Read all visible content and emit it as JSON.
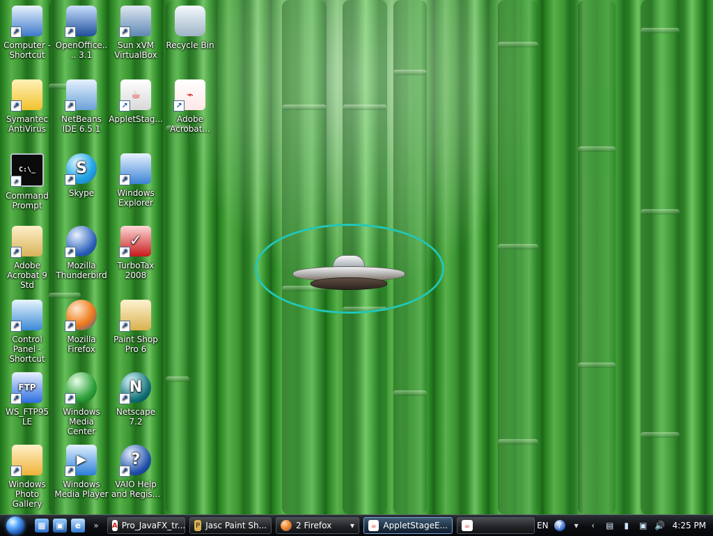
{
  "desktop": {
    "icons": [
      {
        "label": "Computer - Shortcut",
        "icon": "computer-icon",
        "color": "#3c79c9"
      },
      {
        "label": "OpenOffice.... 3.1",
        "icon": "openoffice-icon",
        "color": "#1f4e9a"
      },
      {
        "label": "Sun xVM VirtualBox",
        "icon": "virtualbox-icon",
        "color": "#5e88b3"
      },
      {
        "label": "Recycle Bin",
        "icon": "recycle-bin-icon",
        "color": "#9fb4c6"
      },
      {
        "label": "Symantec AntiVirus",
        "icon": "antivirus-icon",
        "color": "#f2c12e"
      },
      {
        "label": "NetBeans IDE 6.5.1",
        "icon": "netbeans-icon",
        "color": "#6aa1d8"
      },
      {
        "label": "AppletStag...",
        "icon": "java-icon",
        "color": "#e9e9e9"
      },
      {
        "label": "Adobe Acrobat...",
        "icon": "pdf-icon",
        "color": "#d62020"
      },
      {
        "label": "Command Prompt",
        "icon": "command-prompt-icon",
        "color": "#0a0a0a"
      },
      {
        "label": "Skype",
        "icon": "skype-icon",
        "color": "#27a6e7"
      },
      {
        "label": "Windows Explorer",
        "icon": "windows-explorer-icon",
        "color": "#3a83d6"
      },
      {
        "label": "Adobe Acrobat 9 Std",
        "icon": "acrobat-folder-icon",
        "color": "#d8b25a"
      },
      {
        "label": "Mozilla Thunderbird",
        "icon": "thunderbird-icon",
        "color": "#2a5fb8"
      },
      {
        "label": "TurboTax 2008",
        "icon": "turbotax-icon",
        "color": "#c81919"
      },
      {
        "label": "Control Panel - Shortcut",
        "icon": "control-panel-icon",
        "color": "#3a89d6"
      },
      {
        "label": "Mozilla Firefox",
        "icon": "firefox-icon",
        "color": "#ef7b1a"
      },
      {
        "label": "Paint Shop Pro 6",
        "icon": "paint-shop-pro-icon",
        "color": "#d9b24f"
      },
      {
        "label": "WS_FTP95 LE",
        "icon": "ftp-icon",
        "color": "#2d6de0"
      },
      {
        "label": "Windows Media Center",
        "icon": "media-center-icon",
        "color": "#2fa13b"
      },
      {
        "label": "Netscape 7.2",
        "icon": "netscape-icon",
        "color": "#0e6d73"
      },
      {
        "label": "Windows Photo Gallery",
        "icon": "photo-gallery-icon",
        "color": "#f0b23a"
      },
      {
        "label": "Windows Media Player",
        "icon": "media-player-icon",
        "color": "#2b7ed8"
      },
      {
        "label": "VAIO Help and Regis...",
        "icon": "help-icon",
        "color": "#1f4fa8"
      }
    ]
  },
  "taskbar": {
    "start_label": "",
    "quicklaunch": [
      {
        "name": "show-desktop-icon",
        "glyph": "▦"
      },
      {
        "name": "switch-windows-icon",
        "glyph": "▣"
      },
      {
        "name": "ie-icon",
        "glyph": "e"
      },
      {
        "name": "more-icon",
        "glyph": "»"
      }
    ],
    "tasks": [
      {
        "label": "Pro_JavaFX_tr...",
        "icon": "pdf-task-icon",
        "active": false
      },
      {
        "label": "Jasc Paint Sh...",
        "icon": "paint-shop-task-icon",
        "active": false
      },
      {
        "label": "2 Firefox",
        "icon": "firefox-task-icon",
        "active": false
      },
      {
        "label": "AppletStageE...",
        "icon": "java-task-icon",
        "active": true
      },
      {
        "label": "",
        "icon": "java-task-icon-2",
        "active": false
      }
    ],
    "tray": {
      "lang": "EN",
      "time": "4:25 PM"
    }
  },
  "colors": {
    "ring": "#21c7b8"
  }
}
